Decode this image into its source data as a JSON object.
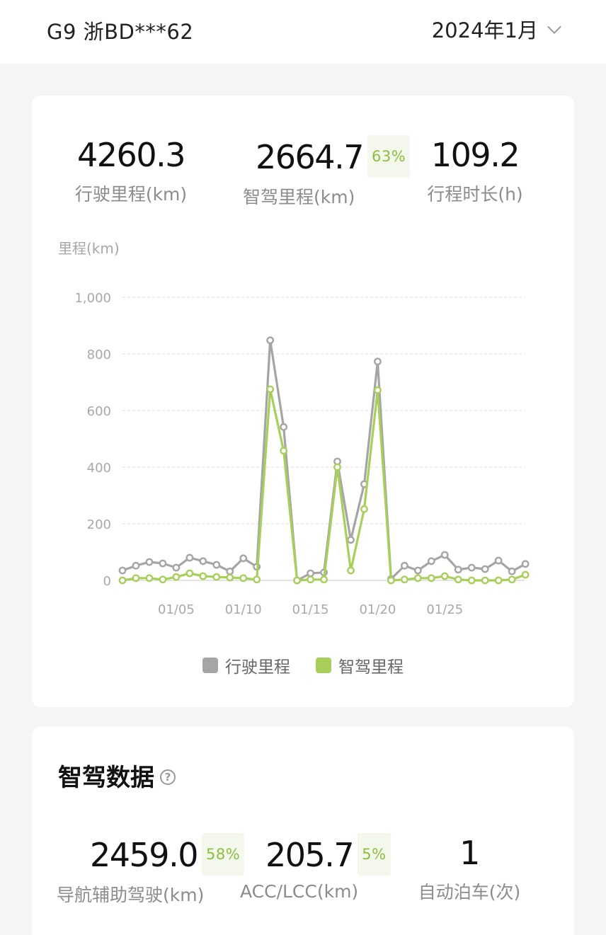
{
  "header": {
    "vehicle": "G9 浙BD***62",
    "month": "2024年1月"
  },
  "summary": {
    "total_distance": "4260.3",
    "total_distance_label": "行驶里程(km)",
    "smart_distance": "2664.7",
    "smart_pct": "63%",
    "smart_distance_label": "智驾里程(km)",
    "duration": "109.2",
    "duration_label": "行程时长(h)"
  },
  "chart_data": {
    "type": "line",
    "ylabel": "里程(km)",
    "ylim": [
      0,
      1000
    ],
    "yticks": [
      "0",
      "200",
      "400",
      "600",
      "800",
      "1,000"
    ],
    "x": [
      1,
      2,
      3,
      4,
      5,
      6,
      7,
      8,
      9,
      10,
      11,
      12,
      13,
      14,
      15,
      16,
      17,
      18,
      19,
      20,
      21,
      22,
      23,
      24,
      25,
      26,
      27,
      28,
      29,
      30,
      31
    ],
    "xticks": [
      {
        "x": 5,
        "label": "01/05"
      },
      {
        "x": 10,
        "label": "01/10"
      },
      {
        "x": 15,
        "label": "01/15"
      },
      {
        "x": 20,
        "label": "01/20"
      },
      {
        "x": 25,
        "label": "01/25"
      }
    ],
    "grid": true,
    "legend": "bottom",
    "series": [
      {
        "name": "行驶里程",
        "color": "#a5a5a8",
        "values": [
          35,
          52,
          65,
          60,
          45,
          80,
          68,
          55,
          32,
          78,
          48,
          848,
          542,
          0,
          25,
          28,
          420,
          143,
          340,
          773,
          5,
          52,
          35,
          68,
          90,
          38,
          45,
          40,
          70,
          32,
          58
        ]
      },
      {
        "name": "智驾里程",
        "color": "#a8cf5a",
        "values": [
          0,
          8,
          8,
          3,
          12,
          25,
          15,
          12,
          10,
          8,
          3,
          675,
          458,
          0,
          3,
          3,
          400,
          35,
          252,
          672,
          0,
          3,
          8,
          8,
          15,
          3,
          0,
          0,
          0,
          3,
          20
        ]
      }
    ]
  },
  "smart_section": {
    "title": "智驾数据",
    "help_icon": "question-icon",
    "nav_distance": "2459.0",
    "nav_pct": "58%",
    "nav_label": "导航辅助驾驶(km)",
    "acc_distance": "205.7",
    "acc_pct": "5%",
    "acc_label": "ACC/LCC(km)",
    "parking_count": "1",
    "parking_label": "自动泊车(次)"
  }
}
